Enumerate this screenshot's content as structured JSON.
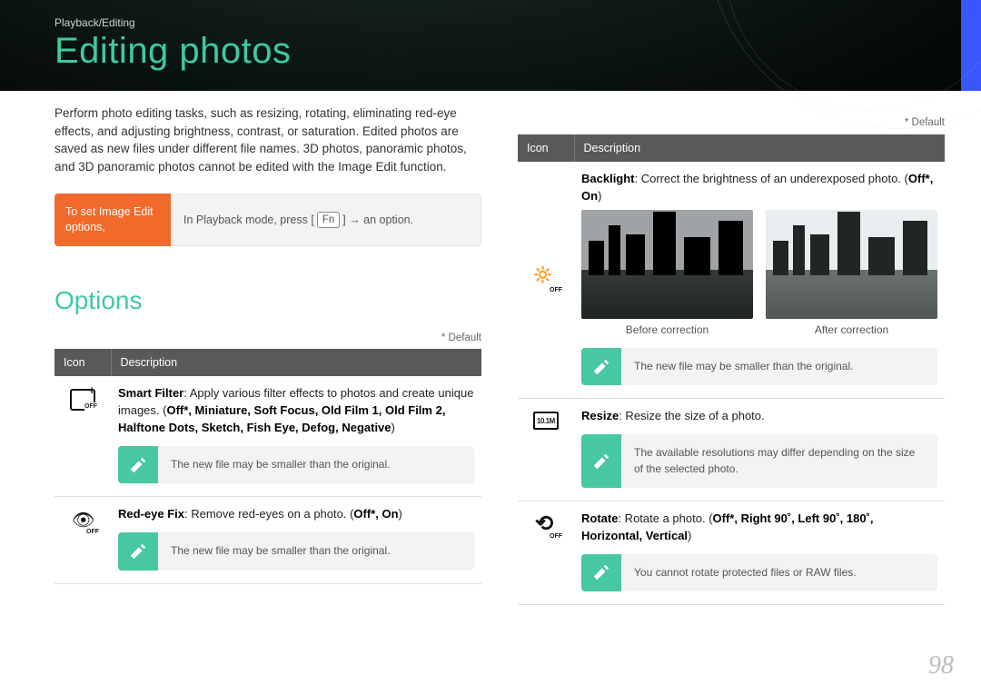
{
  "header": {
    "breadcrumb": "Playback/Editing",
    "title": "Editing photos"
  },
  "intro": "Perform photo editing tasks, such as resizing, rotating, eliminating red-eye effects, and adjusting brightness, contrast, or saturation. Edited photos are saved as new files under different file names. 3D photos, panoramic photos, and 3D panoramic photos cannot be edited with the Image Edit function.",
  "setbox": {
    "label": "To set Image Edit options,",
    "body_prefix": "In Playback mode, press [",
    "fn": "Fn",
    "body_suffix": "] → an option."
  },
  "options_heading": "Options",
  "default_note": "* Default",
  "table_headers": {
    "icon": "Icon",
    "desc": "Description"
  },
  "left_rows": [
    {
      "title": "Smart Filter",
      "body": ": Apply various filter effects to photos and create unique images. (",
      "opts": "Off*, Miniature, Soft Focus, Old Film 1, Old Film 2, Halftone Dots, Sketch, Fish Eye, Defog, Negative",
      "tail": ")",
      "note": "The new file may be smaller than the original."
    },
    {
      "title": "Red-eye Fix",
      "body": ": Remove red-eyes on a photo. (",
      "opts": "Off*, On",
      "tail": ")",
      "note": "The new file may be smaller than the original."
    }
  ],
  "right_rows": [
    {
      "title": "Backlight",
      "body": ": Correct the brightness of an underexposed photo. (",
      "opts": "Off*, On",
      "tail": ")",
      "before": "Before correction",
      "after": "After correction",
      "note": "The new file may be smaller than the original."
    },
    {
      "title": "Resize",
      "body": ": Resize the size of a photo.",
      "note": "The available resolutions may differ depending on the size of the selected photo."
    },
    {
      "title": "Rotate",
      "body": ": Rotate a photo. (",
      "opts": "Off*, Right 90˚, Left 90˚, 180˚, Horizontal, Vertical",
      "tail": ")",
      "note": "You cannot rotate protected files or RAW files."
    }
  ],
  "page_number": "98"
}
